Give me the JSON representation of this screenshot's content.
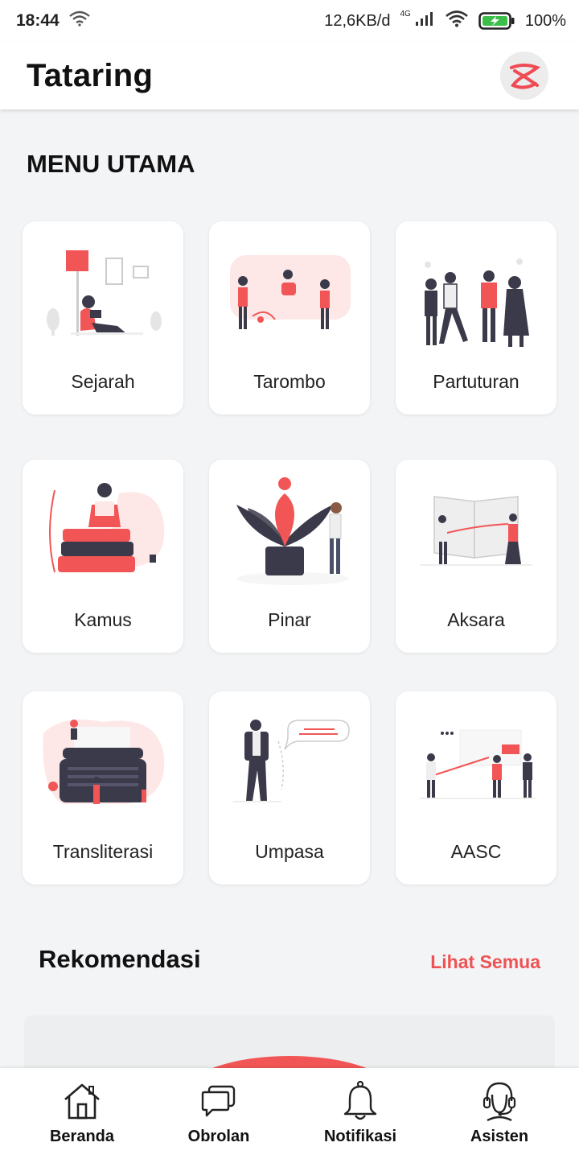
{
  "status_bar": {
    "time": "18:44",
    "network_speed": "12,6KB/d",
    "network_type": "4G",
    "battery": "100%"
  },
  "app_bar": {
    "title": "Tataring",
    "logo_icon": "tataring-logo-icon"
  },
  "menu": {
    "title": "MENU UTAMA",
    "items": [
      {
        "label": "Sejarah",
        "icon": "reading-person-illustration"
      },
      {
        "label": "Tarombo",
        "icon": "family-tree-illustration"
      },
      {
        "label": "Partuturan",
        "icon": "people-group-illustration"
      },
      {
        "label": "Kamus",
        "icon": "books-reading-illustration"
      },
      {
        "label": "Pinar",
        "icon": "flower-plant-illustration"
      },
      {
        "label": "Aksara",
        "icon": "open-book-illustration"
      },
      {
        "label": "Transliterasi",
        "icon": "typewriter-illustration"
      },
      {
        "label": "Umpasa",
        "icon": "speech-bubble-illustration"
      },
      {
        "label": "AASC",
        "icon": "presentation-illustration"
      }
    ]
  },
  "recommendation": {
    "title": "Rekomendasi",
    "see_all": "Lihat Semua"
  },
  "bottom_nav": {
    "items": [
      {
        "label": "Beranda",
        "icon": "home-icon"
      },
      {
        "label": "Obrolan",
        "icon": "chat-icon"
      },
      {
        "label": "Notifikasi",
        "icon": "bell-icon"
      },
      {
        "label": "Asisten",
        "icon": "headset-icon"
      }
    ]
  },
  "colors": {
    "accent": "#ee5253",
    "background": "#f3f4f6",
    "dark": "#3b3a4a"
  }
}
